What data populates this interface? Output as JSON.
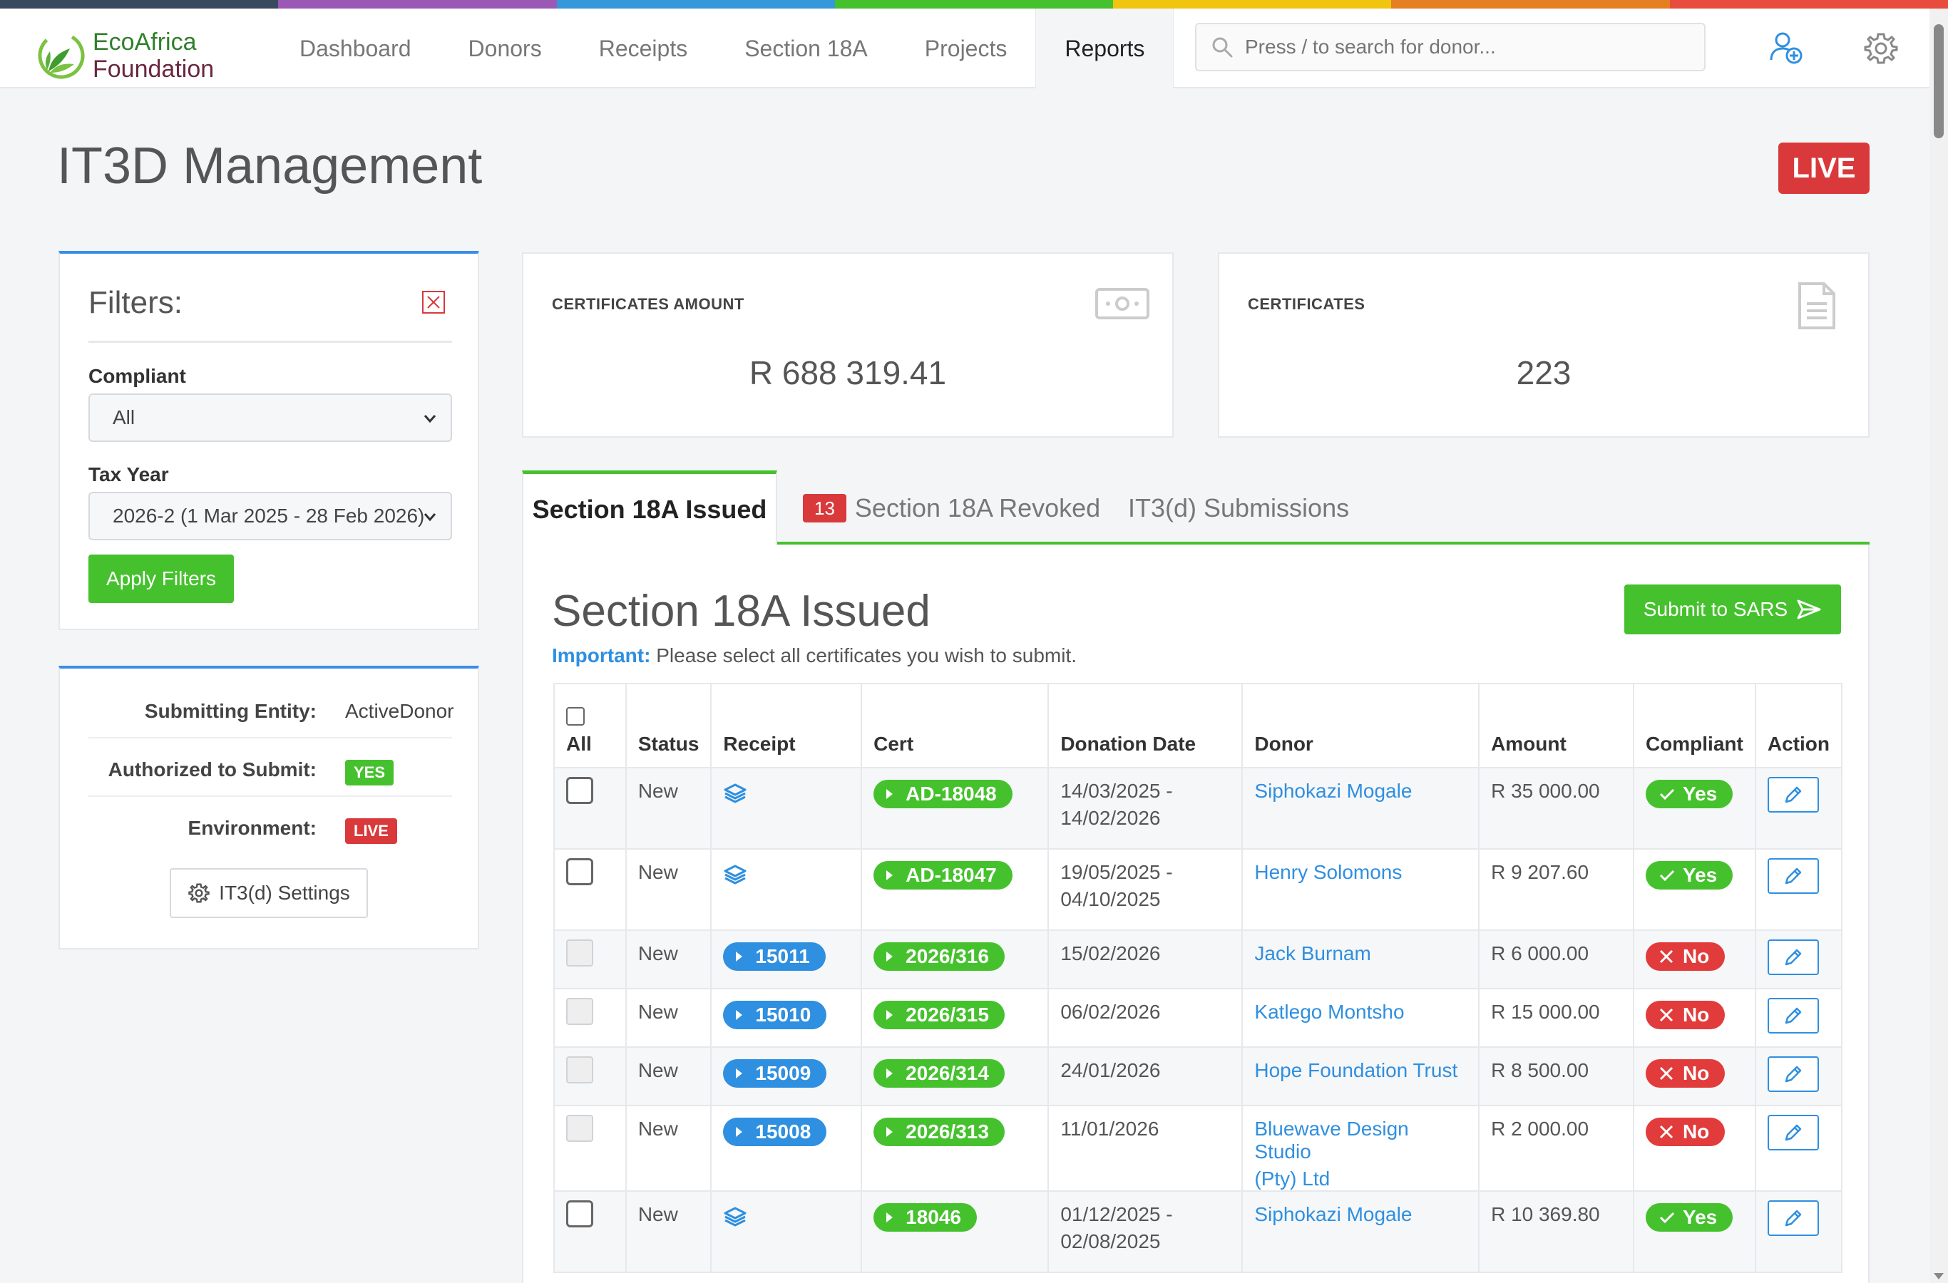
{
  "app": {
    "logo": {
      "line1": "EcoAfrica",
      "line2": "Foundation"
    },
    "nav": [
      "Dashboard",
      "Donors",
      "Receipts",
      "Section 18A",
      "Projects",
      "Reports"
    ],
    "active_nav": "Reports",
    "search_placeholder": "Press / to search for donor..."
  },
  "page": {
    "title": "IT3D Management",
    "env_badge": "LIVE"
  },
  "filters": {
    "title": "Filters:",
    "compliant_label": "Compliant",
    "compliant_value": "All",
    "tax_year_label": "Tax Year",
    "tax_year_value": "2026-2 (1 Mar 2025 - 28 Feb 2026)",
    "apply_label": "Apply Filters"
  },
  "entity": {
    "submitting_label": "Submitting Entity:",
    "submitting_value": "ActiveDonor",
    "authorized_label": "Authorized to Submit:",
    "authorized_value": "YES",
    "environment_label": "Environment:",
    "environment_value": "LIVE",
    "settings_label": "IT3(d) Settings"
  },
  "stats": {
    "amount_label": "CERTIFICATES AMOUNT",
    "amount_value": "R 688 319.41",
    "count_label": "CERTIFICATES",
    "count_value": "223"
  },
  "tabs": {
    "issued": "Section 18A Issued",
    "revoked": "Section 18A Revoked",
    "revoked_count": "13",
    "submissions": "IT3(d) Submissions"
  },
  "section": {
    "title": "Section 18A Issued",
    "submit_label": "Submit to SARS",
    "important_label": "Important:",
    "important_text": "Please select all certificates you wish to submit."
  },
  "table": {
    "headers": [
      "All",
      "Status",
      "Receipt",
      "Cert",
      "Donation Date",
      "Donor",
      "Amount",
      "Compliant",
      "Action"
    ],
    "rows": [
      {
        "status": "New",
        "receipt": "",
        "cert": "AD-18048",
        "date1": "14/03/2025 -",
        "date2": "14/02/2026",
        "donor1": "Siphokazi Mogale",
        "donor2": "",
        "amount": "R 35 000.00",
        "compliant": "Yes"
      },
      {
        "status": "New",
        "receipt": "",
        "cert": "AD-18047",
        "date1": "19/05/2025 -",
        "date2": "04/10/2025",
        "donor1": "Henry Solomons",
        "donor2": "",
        "amount": "R 9 207.60",
        "compliant": "Yes"
      },
      {
        "status": "New",
        "receipt": "15011",
        "cert": "2026/316",
        "date1": "15/02/2026",
        "date2": "",
        "donor1": "Jack Burnam",
        "donor2": "",
        "amount": "R 6 000.00",
        "compliant": "No"
      },
      {
        "status": "New",
        "receipt": "15010",
        "cert": "2026/315",
        "date1": "06/02/2026",
        "date2": "",
        "donor1": "Katlego Montsho",
        "donor2": "",
        "amount": "R 15 000.00",
        "compliant": "No"
      },
      {
        "status": "New",
        "receipt": "15009",
        "cert": "2026/314",
        "date1": "24/01/2026",
        "date2": "",
        "donor1": "Hope Foundation Trust",
        "donor2": "",
        "amount": "R 8 500.00",
        "compliant": "No"
      },
      {
        "status": "New",
        "receipt": "15008",
        "cert": "2026/313",
        "date1": "11/01/2026",
        "date2": "",
        "donor1": "Bluewave Design Studio",
        "donor2": "(Pty) Ltd",
        "amount": "R 2 000.00",
        "compliant": "No"
      },
      {
        "status": "New",
        "receipt": "",
        "cert": "18046",
        "date1": "01/12/2025 -",
        "date2": "02/08/2025",
        "donor1": "Siphokazi Mogale",
        "donor2": "",
        "amount": "R 10 369.80",
        "compliant": "Yes"
      }
    ]
  },
  "colors": {
    "green": "#46c12e",
    "blue": "#2f8fe0",
    "red": "#d9393b",
    "rainbow": [
      "#3a4a5e",
      "#9b59b6",
      "#3498db",
      "#46c12e",
      "#f1c40f",
      "#e67e22",
      "#e74c3c"
    ]
  }
}
